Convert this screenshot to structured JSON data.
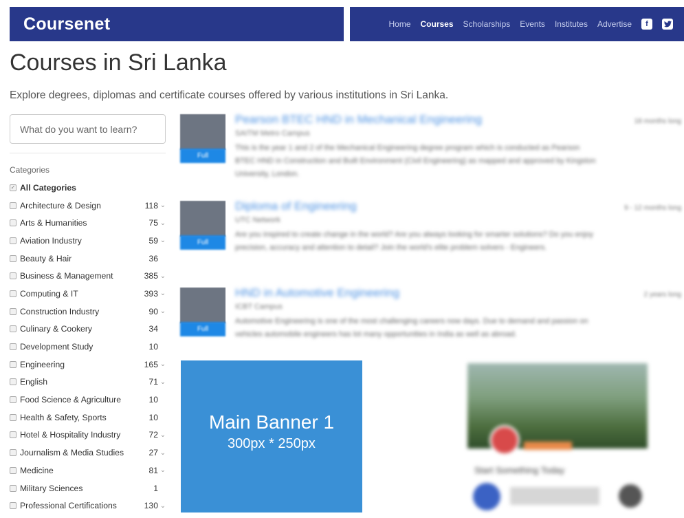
{
  "header": {
    "brand": "Coursenet",
    "nav": [
      "Home",
      "Courses",
      "Scholarships",
      "Events",
      "Institutes",
      "Advertise"
    ],
    "active_nav": "Courses",
    "social": [
      "facebook-icon",
      "twitter-icon"
    ],
    "brand_color": "#28388a"
  },
  "page": {
    "title": "Courses in Sri Lanka",
    "subtitle": "Explore degrees, diplomas and certificate courses offered by various institutions in Sri Lanka."
  },
  "search": {
    "placeholder": "What do you want to learn?"
  },
  "categories": {
    "heading": "Categories",
    "all_label": "All Categories",
    "items": [
      {
        "label": "Architecture & Design",
        "count": "118",
        "expandable": true
      },
      {
        "label": "Arts & Humanities",
        "count": "75",
        "expandable": true
      },
      {
        "label": "Aviation Industry",
        "count": "59",
        "expandable": true
      },
      {
        "label": "Beauty & Hair",
        "count": "36",
        "expandable": false
      },
      {
        "label": "Business & Management",
        "count": "385",
        "expandable": true
      },
      {
        "label": "Computing & IT",
        "count": "393",
        "expandable": true
      },
      {
        "label": "Construction Industry",
        "count": "90",
        "expandable": true
      },
      {
        "label": "Culinary & Cookery",
        "count": "34",
        "expandable": false
      },
      {
        "label": "Development Study",
        "count": "10",
        "expandable": false
      },
      {
        "label": "Engineering",
        "count": "165",
        "expandable": true
      },
      {
        "label": "English",
        "count": "71",
        "expandable": true
      },
      {
        "label": "Food Science & Agriculture",
        "count": "10",
        "expandable": false
      },
      {
        "label": "Health & Safety, Sports",
        "count": "10",
        "expandable": false
      },
      {
        "label": "Hotel & Hospitality Industry",
        "count": "72",
        "expandable": true
      },
      {
        "label": "Journalism & Media Studies",
        "count": "27",
        "expandable": true
      },
      {
        "label": "Medicine",
        "count": "81",
        "expandable": true
      },
      {
        "label": "Military Sciences",
        "count": "1",
        "expandable": false
      },
      {
        "label": "Professional Certifications",
        "count": "130",
        "expandable": true
      }
    ]
  },
  "courses": [
    {
      "title": "Pearson BTEC HND in Mechanical Engineering",
      "institute": "SAITM Metro Campus",
      "description": "This is the year 1 and 2 of the Mechanical Engineering degree program which is conducted as Pearson BTEC HND in Construction and Built Environment (Civil Engineering) as mapped and approved by Kingston University, London.",
      "meta": "18 months long",
      "button": "Full"
    },
    {
      "title": "Diploma of Engineering",
      "institute": "UTC Network",
      "description": "Are you inspired to create change in the world? Are you always looking for smarter solutions? Do you enjoy precision, accuracy and attention to detail? Join the world's elite problem solvers - Engineers.",
      "meta": "9 - 12 months long",
      "button": "Full"
    },
    {
      "title": "HND in Automotive Engineering",
      "institute": "ICBT Campus",
      "description": "Automotive Engineering is one of the most challenging careers now days. Due to demand and passion on vehicles automobile engineers has lot many opportunities in India as well as abroad.",
      "meta": "2 years long",
      "button": "Full"
    }
  ],
  "banner": {
    "line1": "Main Banner 1",
    "line2": "300px * 250px",
    "color": "#3a90d6"
  },
  "fb_widget": {
    "name": "Start Something Today"
  }
}
